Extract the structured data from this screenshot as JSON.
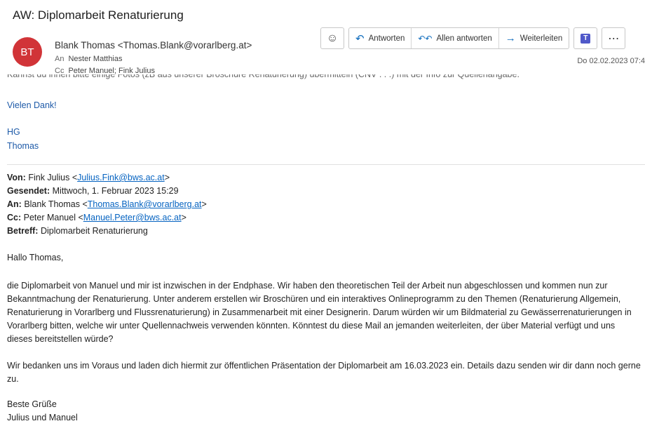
{
  "subject": "AW: Diplomarbeit Renaturierung",
  "avatar_initials": "BT",
  "header": {
    "from": "Blank Thomas <Thomas.Blank@vorarlberg.at>",
    "to_label": "An",
    "to": "Nester Matthias",
    "cc_label": "Cc",
    "cc": "Peter Manuel; Fink Julius",
    "date": "Do 02.02.2023 07:4"
  },
  "toolbar": {
    "emoji_icon": "☺",
    "reply_icon": "↶",
    "reply": "Antworten",
    "reply_all_icon": "↶↶",
    "reply_all": "Allen antworten",
    "forward_icon": "→",
    "forward": "Weiterleiten",
    "teams_icon": "T",
    "more_icon": "⋯"
  },
  "body": {
    "cut_line": "Kannst du ihnen bitte einige Fotos (zB aus unserer Broschüre Renaturierung) übermitteln (CNV . . .) mit der Info zur Quellenangabe.",
    "thanks": "Vielen Dank!",
    "sign1": "HG",
    "sign2": "Thomas",
    "quoted": {
      "von_label": "Von:",
      "von_name": "Fink Julius <",
      "von_email": "Julius.Fink@bws.ac.at",
      "von_close": ">",
      "sent_label": "Gesendet:",
      "sent": "Mittwoch, 1. Februar 2023 15:29",
      "an_label": "An:",
      "an_name": "Blank Thomas <",
      "an_email": "Thomas.Blank@vorarlberg.at",
      "an_close": ">",
      "cc_label": "Cc:",
      "cc_name": "Peter Manuel <",
      "cc_email": "Manuel.Peter@bws.ac.at",
      "cc_close": ">",
      "betreff_label": "Betreff:",
      "betreff": "Diplomarbeit Renaturierung"
    },
    "greeting": "Hallo Thomas,",
    "para1": "die Diplomarbeit von Manuel und mir ist inzwischen in der Endphase. Wir haben den theoretischen Teil der Arbeit nun abgeschlossen und kommen nun zur Bekanntmachung der Renaturierung. Unter anderem erstellen wir Broschüren und ein interaktives Onlineprogramm zu den Themen (Renaturierung Allgemein, Renaturierung in Vorarlberg und Flussrenaturierung) in Zusammenarbeit mit einer Designerin. Darum würden wir um Bildmaterial zu Gewässerrenaturierungen in Vorarlberg bitten, welche wir unter Quellennachweis verwenden könnten. Könntest du diese Mail an jemanden weiterleiten, der über Material verfügt und uns dieses bereitstellen würde?",
    "para2": "Wir bedanken uns im Voraus und laden dich hiermit zur öffentlichen Präsentation der Diplomarbeit am 16.03.2023 ein. Details dazu senden wir dir dann noch gerne zu.",
    "closing": "Beste Grüße",
    "names": "Julius und Manuel"
  }
}
